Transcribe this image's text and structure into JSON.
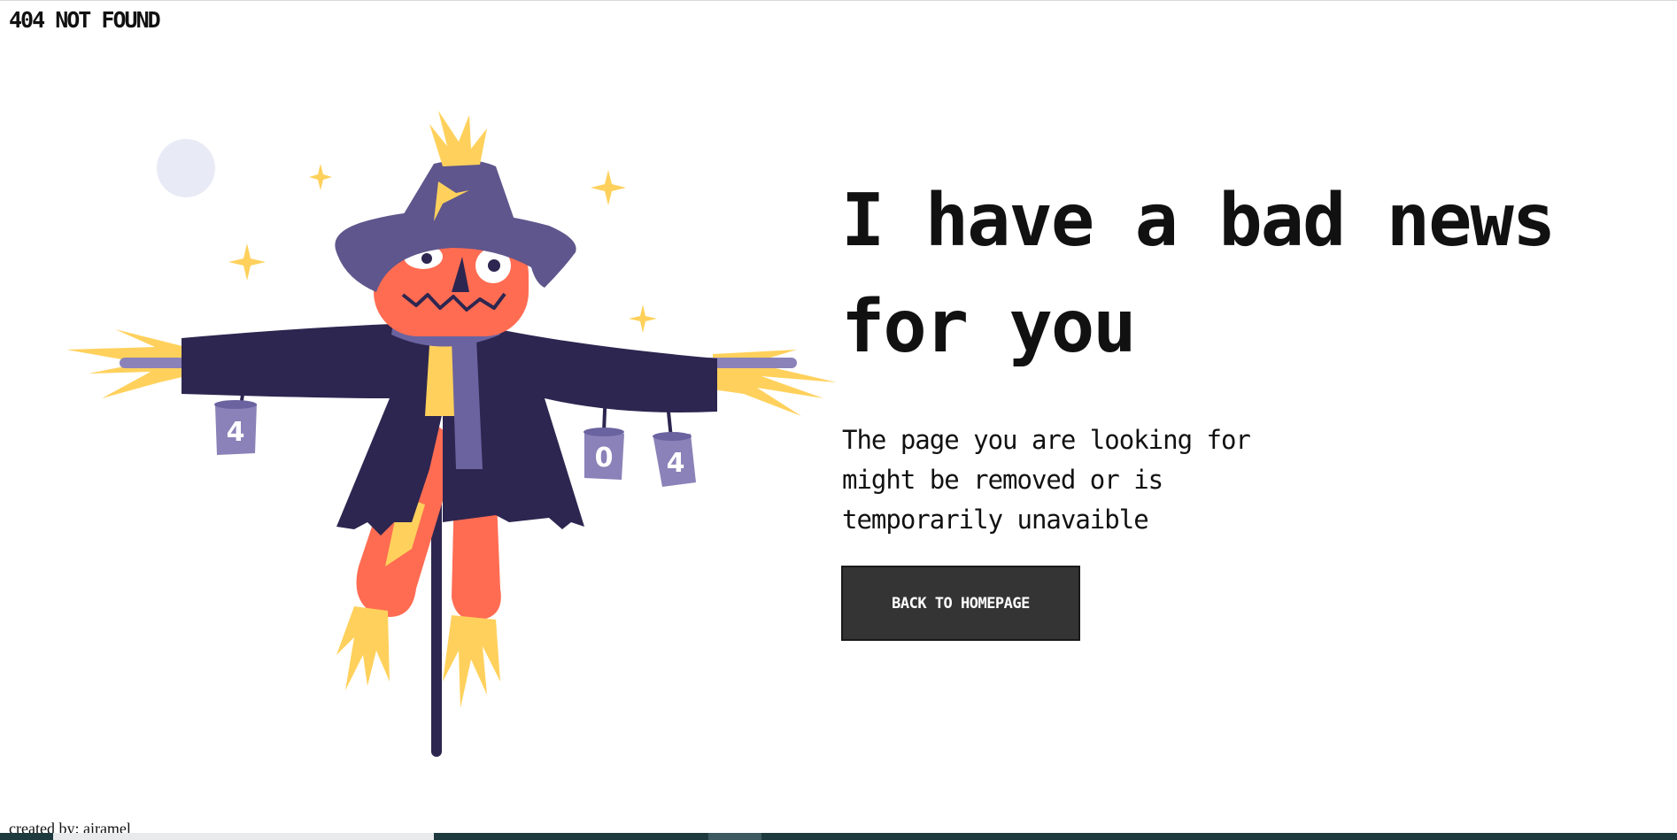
{
  "header": {
    "title": "404 NOT FOUND"
  },
  "main": {
    "headline": "I have a bad news for you",
    "description": "The page you are looking for might be removed or is temporarily unavaible",
    "button_label": "BACK TO HOMEPAGE"
  },
  "illustration": {
    "can_labels": [
      "4",
      "0",
      "4"
    ],
    "colors": {
      "hat": "#5e568c",
      "coat": "#2d2650",
      "face": "#ff6c52",
      "straw": "#ffd15c",
      "scarf": "#6b63a0",
      "can": "#8a82b8",
      "moon": "#e8ebf5"
    }
  },
  "footer": {
    "credit": "created by: airamel"
  }
}
